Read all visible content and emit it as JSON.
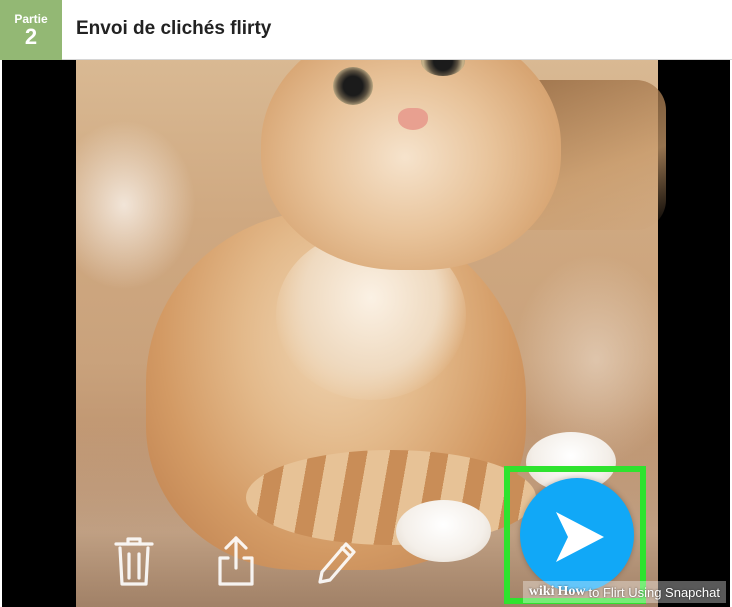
{
  "section": {
    "part_label": "Partie",
    "part_number": "2",
    "title": "Envoi de clichés flirty"
  },
  "image": {
    "subject": "kitten photo",
    "toolbar_icons": [
      "trash-icon",
      "share-icon",
      "pencil-icon"
    ],
    "send_icon": "send-arrow-icon",
    "highlight_color": "#2ee32e",
    "send_button_color": "#11a8f7"
  },
  "watermark": {
    "wiki": "wiki",
    "how": "How",
    "title": "to Flirt Using Snapchat"
  },
  "colors": {
    "badge_green": "#93b874",
    "title_text": "#222222"
  }
}
